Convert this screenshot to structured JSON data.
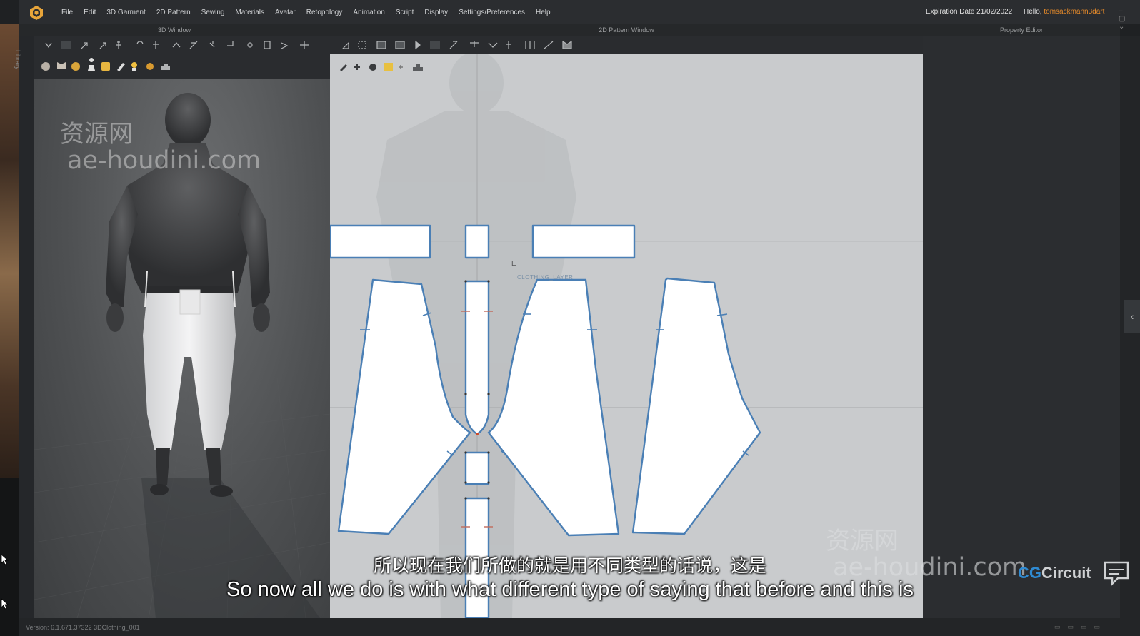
{
  "menubar": {
    "items": [
      "File",
      "Edit",
      "3D Garment",
      "2D Pattern",
      "Sewing",
      "Materials",
      "Avatar",
      "Retopology",
      "Animation",
      "Script",
      "Display",
      "Settings/Preferences",
      "Help"
    ],
    "expiration": "Expiration Date 21/02/2022",
    "hello_prefix": "Hello,",
    "username": "tomsackmann3dart",
    "accent_color": "#e58a2a"
  },
  "panels": {
    "window_3d": "3D Window",
    "window_2d": "2D Pattern Window",
    "property_editor": "Property Editor",
    "library": "Library"
  },
  "pattern": {
    "cursor_label": "E",
    "cursor_sublabel": "CLOTHING_LAYER"
  },
  "watermarks": {
    "cn": "资源网",
    "url": "ae-houdini.com"
  },
  "brand": {
    "prefix": "CG",
    "name": "Circuit",
    "color": "#2f8ad1"
  },
  "subtitles": {
    "cn": "所以现在我们所做的就是用不同类型的话说，这是",
    "en": "So now all we do is with what different type of saying that before and this is"
  },
  "statusbar": {
    "text": "Version: 6.1.671.37322    3DClothing_001"
  },
  "icons": [
    "app-logo-icon",
    "select-icon",
    "brush-icon",
    "avatar-icon",
    "pattern-icon",
    "chevron-left-icon",
    "cursor-icon"
  ]
}
